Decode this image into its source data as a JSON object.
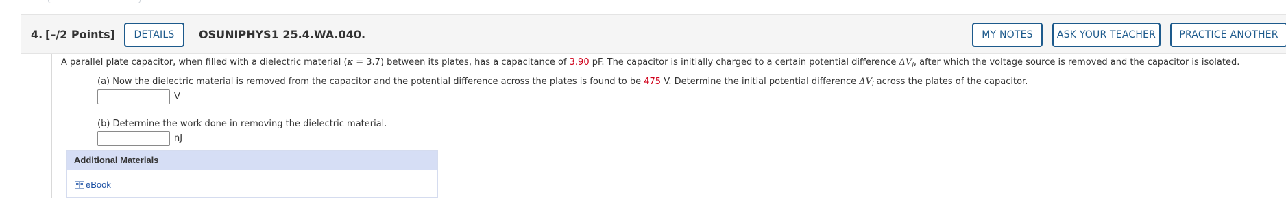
{
  "header": {
    "question_number": "4.",
    "points": "[–/2 Points]",
    "details_label": "DETAILS",
    "question_code": "OSUNIPHYS1 25.4.WA.040.",
    "my_notes_label": "MY NOTES",
    "ask_teacher_label": "ASK YOUR TEACHER",
    "practice_another_label": "PRACTICE ANOTHER"
  },
  "question": {
    "t1": "A parallel plate capacitor, when filled with a dielectric material (",
    "kappa": "κ",
    "t2": " = 3.7) between its plates, has a capacitance of ",
    "capacitance": "3.90",
    "t3": " pF. The capacitor is initially charged to a certain potential difference ",
    "dv": "ΔV",
    "dv_sub": "i",
    "t4": ", after which the voltage source is removed and the capacitor is isolated."
  },
  "part_a": {
    "t1": "(a) Now the dielectric material is removed from the capacitor and the potential difference across the plates is found to be ",
    "voltage": "475",
    "t2": " V. Determine the initial potential difference ",
    "dv": "ΔV",
    "dv_sub": "i",
    "t3": " across the plates of the capacitor.",
    "answer_value": "",
    "unit": "V"
  },
  "part_b": {
    "text": "(b) Determine the work done in removing the dielectric material.",
    "answer_value": "",
    "unit": "nJ"
  },
  "additional_materials": {
    "heading": "Additional Materials",
    "ebook_label": "eBook",
    "ebook_icon": "book-icon"
  },
  "colors": {
    "accent": "#1d5a8c",
    "highlight_red": "#d0021b",
    "materials_header_bg": "#d6def5"
  }
}
